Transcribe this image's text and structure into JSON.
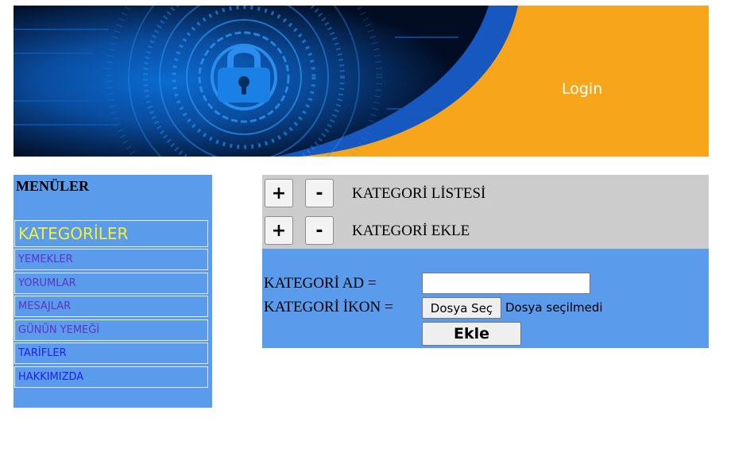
{
  "banner": {
    "login_label": "Login",
    "colors": {
      "dark": "#031a3a",
      "blue": "#0a6fd6",
      "orange": "#f7a51b"
    }
  },
  "sidebar": {
    "title": "MENÜLER",
    "items": [
      {
        "label": "KATEGORİLER"
      },
      {
        "label": "YEMEKLER"
      },
      {
        "label": "YORUMLAR"
      },
      {
        "label": "MESAJLAR"
      },
      {
        "label": "GÜNÜN YEMEĞİ"
      },
      {
        "label": "TARİFLER"
      },
      {
        "label": "HAKKIMIZDA"
      }
    ]
  },
  "main": {
    "toggles": [
      {
        "plus": "+",
        "minus": "-",
        "label": "KATEGORİ LİSTESİ"
      },
      {
        "plus": "+",
        "minus": "-",
        "label": "KATEGORİ EKLE"
      }
    ],
    "form": {
      "name_label": "KATEGORİ AD =",
      "name_value": "",
      "icon_label": "KATEGORİ İKON =",
      "file_button": "Dosya Seç",
      "file_status": "Dosya seçilmedi",
      "submit": "Ekle"
    }
  }
}
